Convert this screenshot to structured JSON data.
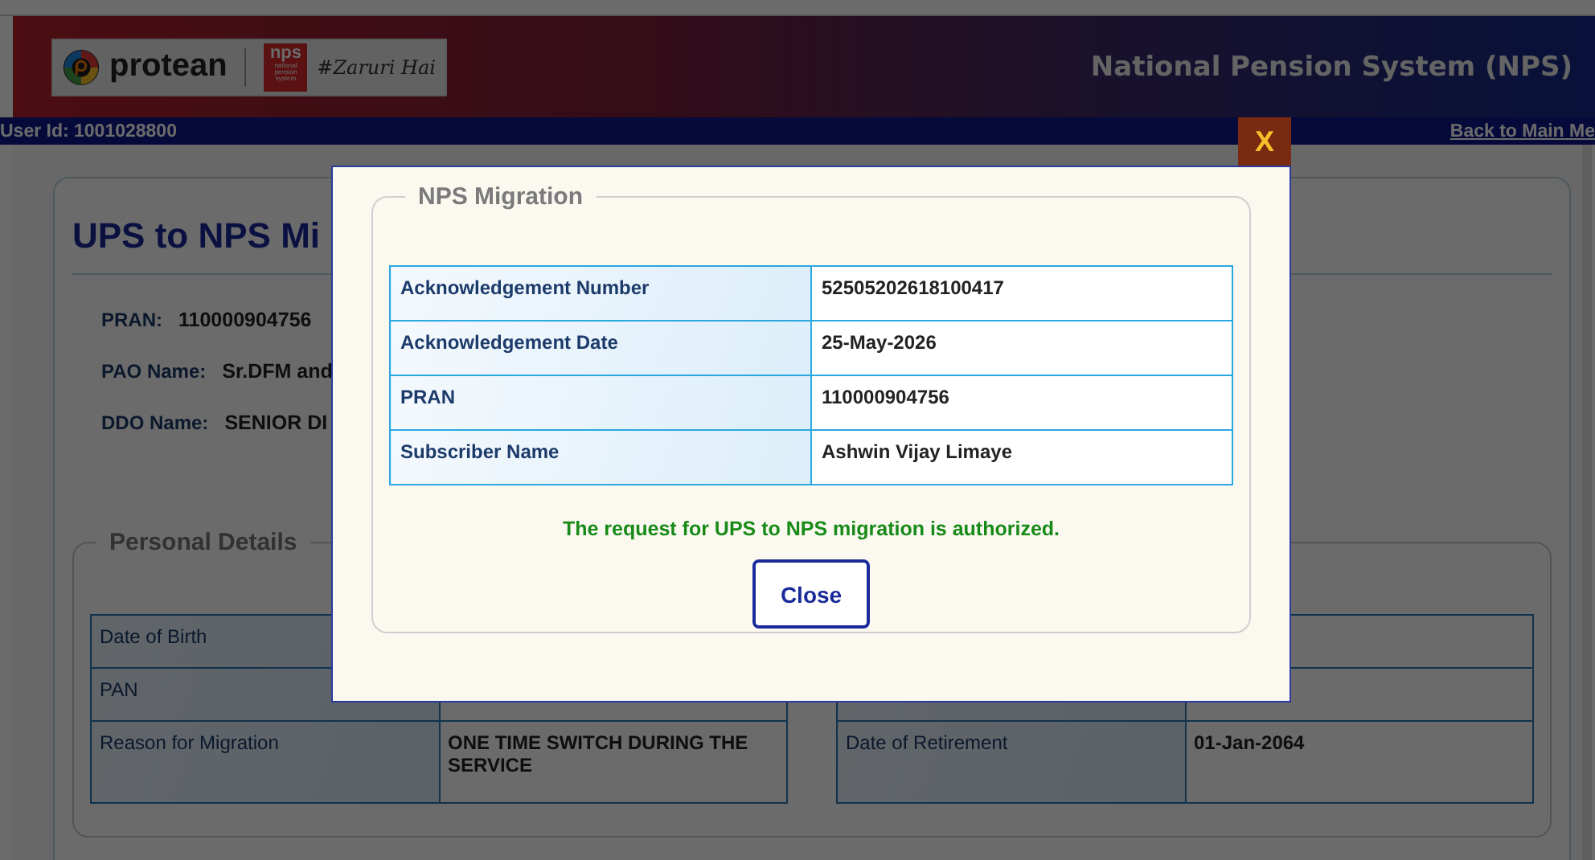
{
  "header": {
    "logo": {
      "brand": "protean",
      "badge": "nps",
      "badge_caption": "national pension system",
      "tagline": "#Zaruri Hai"
    },
    "title": "National Pension System (NPS)"
  },
  "user_bar": {
    "user_id": "User Id: 1001028800",
    "back_link": "Back to Main Me"
  },
  "page": {
    "title": "UPS to NPS Mi",
    "fields": [
      {
        "label": "PRAN:",
        "value": "110000904756"
      },
      {
        "label": "PAO Name:",
        "value": "Sr.DFM and"
      },
      {
        "label": "DDO Name:",
        "value": "SENIOR DI"
      }
    ],
    "personal_details": {
      "legend": "Personal Details",
      "left_table": [
        {
          "label": "Date of Birth"
        },
        {
          "label": "PAN"
        },
        {
          "label": "Reason for Migration",
          "value": "ONE TIME SWITCH DURING THE SERVICE"
        }
      ],
      "right_table": [
        {
          "label": "Date of Retirement",
          "value": "01-Jan-2064"
        }
      ]
    }
  },
  "dialog": {
    "close_icon": "X",
    "legend": "NPS Migration",
    "rows": [
      {
        "label": "Acknowledgement Number",
        "value": "52505202618100417"
      },
      {
        "label": "Acknowledgement Date",
        "value": "25-May-2026"
      },
      {
        "label": "PRAN",
        "value": "110000904756"
      },
      {
        "label": "Subscriber Name",
        "value": "Ashwin Vijay Limaye"
      }
    ],
    "message": "The request for UPS to NPS migration is authorized.",
    "button": "Close"
  }
}
